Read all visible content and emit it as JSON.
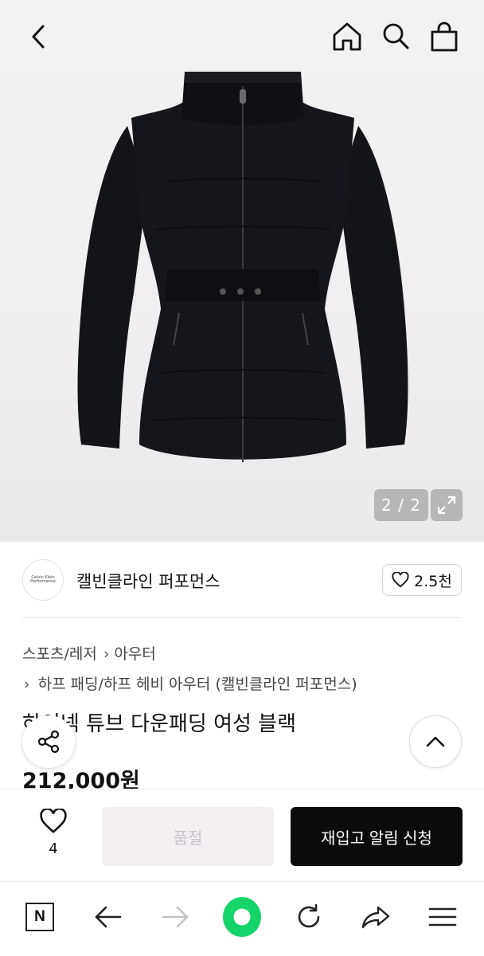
{
  "header": {
    "icons": [
      "chevron-left-icon",
      "home-icon",
      "search-icon",
      "shopping-bag-icon"
    ]
  },
  "gallery": {
    "counter": "2 / 2",
    "current": 2,
    "total": 2
  },
  "brand": {
    "name": "캘빈클라인 퍼포먼스",
    "logo_text": "Calvin Klein Performance",
    "likes": "2.5천"
  },
  "category": {
    "level1": "스포츠/레저",
    "level2": "아우터",
    "sub": "하프 패딩/하프 헤비 아우터 (캘빈클라인 퍼포먼스)"
  },
  "product": {
    "title": "하이넥 튜브 다운패딩 여성 블랙",
    "price": "212,000원"
  },
  "purchase": {
    "wish_count": "4",
    "soldout_label": "품절",
    "restock_label": "재입고 알림 신청"
  },
  "browser_bar": {
    "n_label": "N"
  },
  "colors": {
    "accent": "#0b0b0b",
    "soldout_bg": "#f3eff3",
    "browser_green": "#15d56a"
  }
}
